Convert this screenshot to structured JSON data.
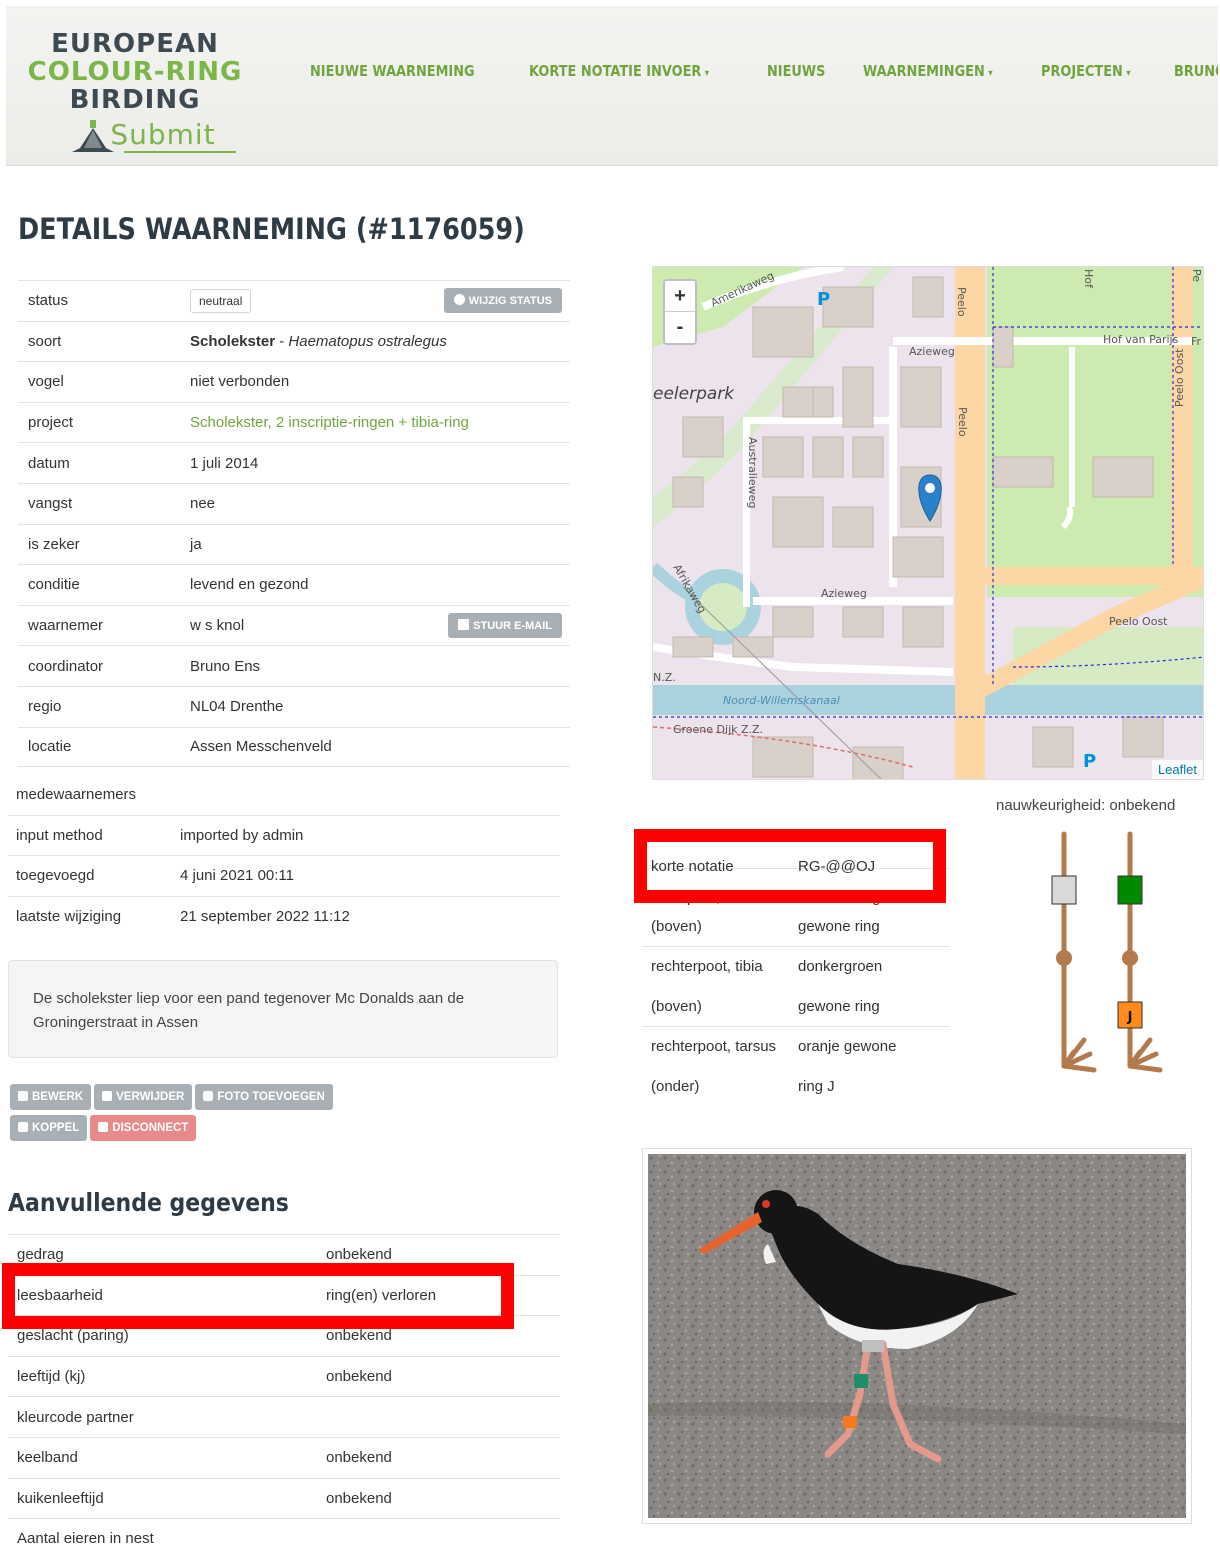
{
  "header": {
    "logo": {
      "line1": "EUROPEAN",
      "line2": "COLOUR-RING",
      "line3": "BIRDING",
      "line4": "Submit"
    },
    "nav": [
      {
        "label": "NIEUWE WAARNEMING",
        "caret": ""
      },
      {
        "label": "KORTE NOTATIE INVOER",
        "caret": "▾"
      },
      {
        "label": "NIEUWS",
        "caret": ""
      },
      {
        "label": "WAARNEMINGEN",
        "caret": "▾"
      },
      {
        "label": "PROJECTEN",
        "caret": "▾"
      },
      {
        "label": "BRUNOJENS",
        "caret": ""
      }
    ]
  },
  "page_title": "DETAILS WAARNEMING (#1176059)",
  "details": {
    "status": {
      "label": "status",
      "value": "neutraal",
      "button": "WIJZIG STATUS"
    },
    "soort": {
      "label": "soort",
      "common": "Scholekster",
      "sep": " - ",
      "latin": "Haematopus ostralegus"
    },
    "vogel": {
      "label": "vogel",
      "value": "niet verbonden"
    },
    "project": {
      "label": "project",
      "value": "Scholekster, 2 inscriptie-ringen + tibia-ring"
    },
    "datum": {
      "label": "datum",
      "value": "1 juli 2014"
    },
    "vangst": {
      "label": "vangst",
      "value": "nee"
    },
    "is_zeker": {
      "label": "is zeker",
      "value": "ja"
    },
    "conditie": {
      "label": "conditie",
      "value": "levend en gezond"
    },
    "waarnemer": {
      "label": "waarnemer",
      "value": "w s knol",
      "button": "STUUR E-MAIL"
    },
    "coordinator": {
      "label": "coordinator",
      "value": "Bruno Ens"
    },
    "regio": {
      "label": "regio",
      "value": "NL04 Drenthe"
    },
    "locatie": {
      "label": "locatie",
      "value": "Assen Messchenveld"
    }
  },
  "meta": {
    "medewaarnemers": {
      "label": "medewaarnemers",
      "value": ""
    },
    "input_method": {
      "label": "input method",
      "value": "imported by admin"
    },
    "toegevoegd": {
      "label": "toegevoegd",
      "value": "4 juni 2021 00:11"
    },
    "laatste_wijziging": {
      "label": "laatste wijziging",
      "value": "21 september 2022 11:12"
    }
  },
  "note": "De scholekster liep voor een pand tegenover Mc Donalds aan de Groningerstraat in Assen",
  "actions": {
    "bewerk": "BEWERK",
    "verwijder": "VERWIJDER",
    "foto": "FOTO TOEVOEGEN",
    "koppel": "KOPPEL",
    "disconnect": "DISCONNECT"
  },
  "aanvullend": {
    "title": "Aanvullende gegevens",
    "rows": [
      {
        "label": "gedrag",
        "value": "onbekend"
      },
      {
        "label": "leesbaarheid",
        "value": "ring(en) verloren"
      },
      {
        "label": "geslacht (paring)",
        "value": "onbekend"
      },
      {
        "label": "leeftijd (kj)",
        "value": "onbekend"
      },
      {
        "label": "kleurcode partner",
        "value": ""
      },
      {
        "label": "keelband",
        "value": "onbekend"
      },
      {
        "label": "kuikenleeftijd",
        "value": "onbekend"
      },
      {
        "label": "Aantal eieren in nest",
        "value": ""
      }
    ]
  },
  "map": {
    "zoom_in": "+",
    "zoom_out": "-",
    "attribution": "Leaflet",
    "labels": {
      "amerikaweg": "Amerikaweg",
      "azieweg": "Azieweg",
      "peelo": "Peelo",
      "hof_van_parijs": "Hof van Parijs",
      "peelo_oost": "Peelo Oost",
      "eelerpark": "eelerpark",
      "australieweg": "Australieweg",
      "afrikaweg": "Afrikaweg",
      "noord_willemskanaal": "Noord-Willemskanaal",
      "groene_dijk": "Groene Dijk Z.Z.",
      "nz": "N.Z.",
      "hof": "Hof",
      "pe": "Pe",
      "fr": "Fr",
      "parking": "P"
    },
    "precision": "nauwkeurigheid: onbekend"
  },
  "rings": {
    "korte_notatie": {
      "label": "korte notatie",
      "value": "RG-@@OJ"
    },
    "rows": [
      {
        "label": "linkerpoot, tibia",
        "value": "metalen ring"
      },
      {
        "label": "(boven)",
        "value": "gewone ring"
      },
      {
        "label": "rechterpoot, tibia",
        "value": "donkergroen"
      },
      {
        "label": "(boven)",
        "value": "gewone ring"
      },
      {
        "label": "rechterpoot, tarsus",
        "value": "oranje gewone"
      },
      {
        "label": "(onder)",
        "value": "ring J"
      }
    ],
    "diagram": {
      "left_tibia_color": "#d9d9d9",
      "right_tibia_color": "#008a00",
      "right_tarsus_color": "#ff8c1a",
      "right_tarsus_letter": "J"
    }
  },
  "colors": {
    "accent": "#6ea63c",
    "highlight": "#ff0000",
    "button_grey": "#a9b0b5",
    "button_red": "#e88a8a"
  }
}
